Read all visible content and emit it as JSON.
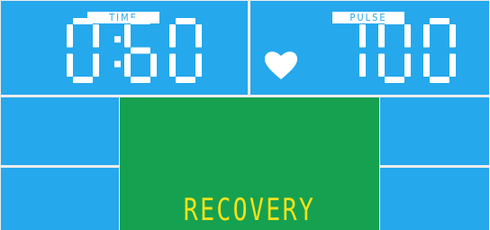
{
  "display": {
    "time_label": "TIME",
    "time_value": "0:60",
    "pulse_label": "PULSE",
    "pulse_value": "100",
    "heart_icon": "heart-icon",
    "mode_text": "RECOVERY"
  },
  "colors": {
    "panel_blue": "#25a8ec",
    "center_green": "#16a150",
    "segment_white": "#ffffff",
    "mode_text_yellow": "#f4e21a"
  }
}
